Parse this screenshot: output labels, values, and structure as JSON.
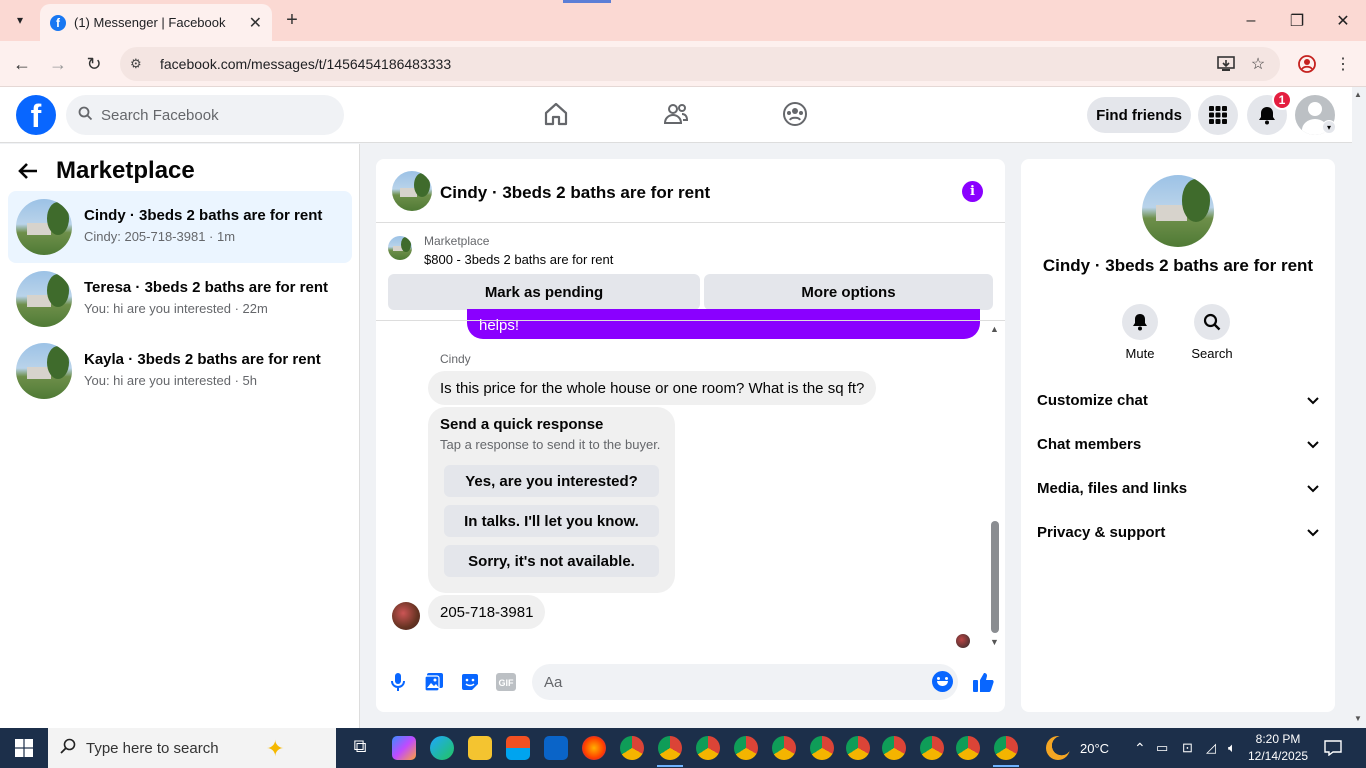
{
  "browser": {
    "tab_title": "(1) Messenger | Facebook",
    "url": "facebook.com/messages/t/1456454186483333"
  },
  "fb_header": {
    "search_placeholder": "Search Facebook",
    "find_friends": "Find friends",
    "notification_count": "1"
  },
  "left": {
    "title": "Marketplace",
    "conversations": [
      {
        "name": "Cindy · 3beds 2 baths are for rent",
        "preview": "Cindy: 205-718-3981 · 1m"
      },
      {
        "name": "Teresa · 3beds 2 baths are for rent",
        "preview": "You: hi are you interested · 22m"
      },
      {
        "name": "Kayla · 3beds 2 baths are for rent",
        "preview": "You: hi are you interested · 5h"
      }
    ]
  },
  "chat": {
    "title": "Cindy · 3beds 2 baths are for rent",
    "marketplace_label": "Marketplace",
    "listing": "$800 - 3beds 2 baths are for rent",
    "mark_pending": "Mark as pending",
    "more_options": "More options",
    "cut_message": "helps!",
    "sender_label": "Cindy",
    "message_1": "Is this price for the whole house or one room? What is the sq ft?",
    "quick_title": "Send a quick response",
    "quick_sub": "Tap a response to send it to the buyer.",
    "quick_options": [
      "Yes, are you interested?",
      "In talks. I'll let you know.",
      "Sorry, it's not available."
    ],
    "message_2": "205-718-3981",
    "composer_placeholder": "Aa"
  },
  "right": {
    "name": "Cindy · 3beds 2 baths are for rent",
    "mute": "Mute",
    "search": "Search",
    "sections": [
      "Customize chat",
      "Chat members",
      "Media, files and links",
      "Privacy & support"
    ]
  },
  "taskbar": {
    "search_placeholder": "Type here to search",
    "temperature": "20°C",
    "time": "8:20 PM",
    "date": "12/14/2025"
  },
  "colors": {
    "fb_blue": "#0866ff",
    "messenger_purple": "#8a00ff",
    "notification_red": "#e41e3f"
  }
}
